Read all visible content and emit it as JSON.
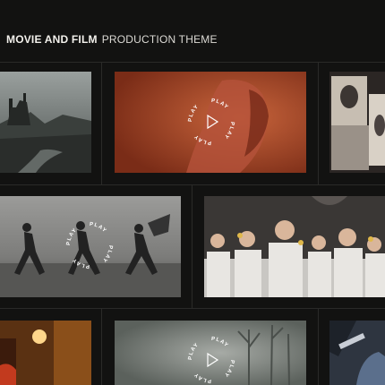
{
  "header": {
    "title_bold": "MOVIE AND FILM",
    "title_rest": "PRODUCTION THEME"
  },
  "play": {
    "label": "PLAY"
  },
  "colors": {
    "background": "#121211",
    "divider": "#2a2a28"
  },
  "tiles": [
    {
      "name": "castle-landscape",
      "has_play": false
    },
    {
      "name": "red-portrait",
      "has_play": true
    },
    {
      "name": "vintage-photos",
      "has_play": false
    },
    {
      "name": "running-figures",
      "has_play": true
    },
    {
      "name": "choir-boys",
      "has_play": false
    },
    {
      "name": "warm-interior",
      "has_play": false
    },
    {
      "name": "foggy-forest",
      "has_play": true
    },
    {
      "name": "blue-still",
      "has_play": false
    }
  ]
}
